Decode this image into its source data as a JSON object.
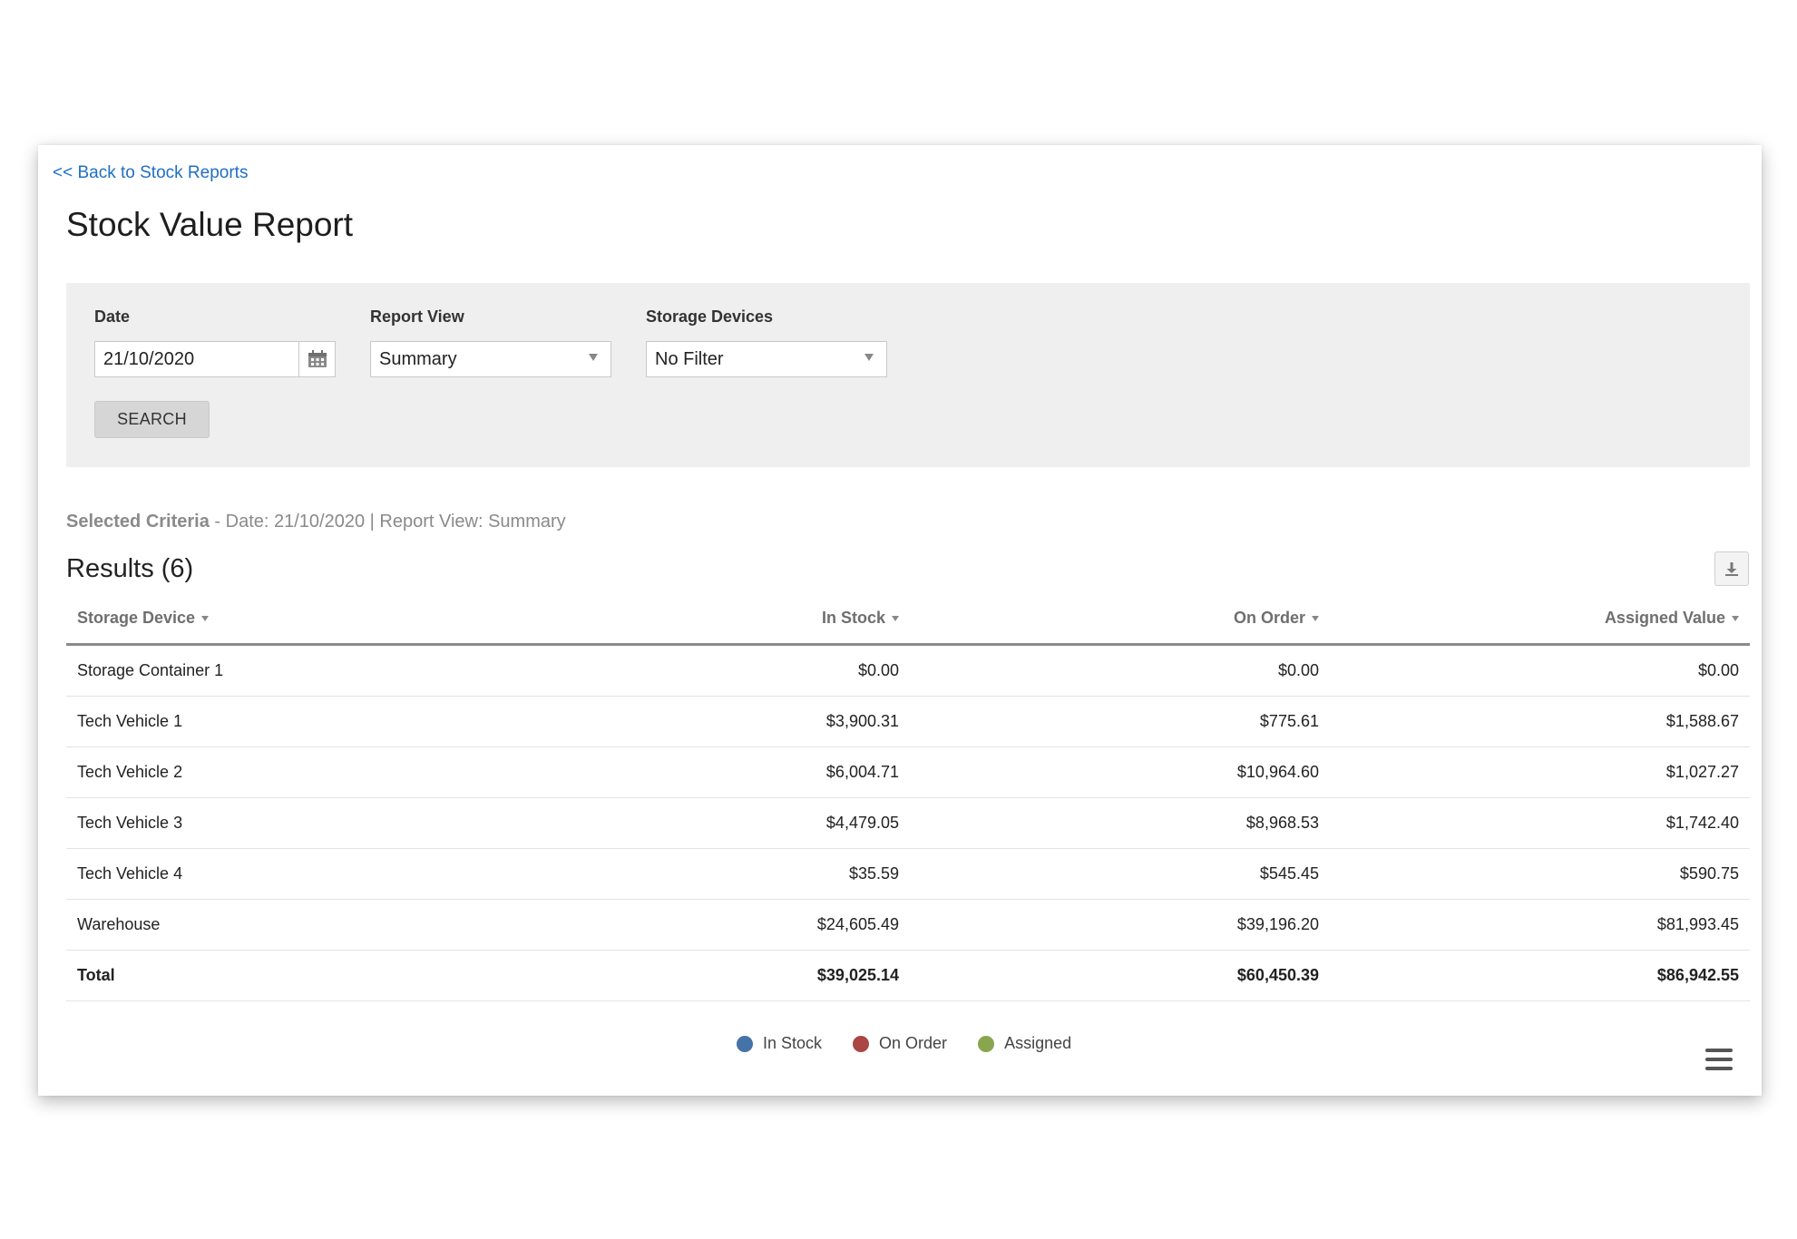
{
  "nav": {
    "back_link": "<< Back to Stock Reports"
  },
  "page": {
    "title": "Stock Value Report"
  },
  "filters": {
    "date": {
      "label": "Date",
      "value": "21/10/2020"
    },
    "report_view": {
      "label": "Report View",
      "selected": "Summary"
    },
    "storage_devices": {
      "label": "Storage Devices",
      "selected": "No Filter"
    },
    "search_label": "SEARCH"
  },
  "criteria": {
    "label": "Selected Criteria",
    "text": " - Date: 21/10/2020 | Report View: Summary"
  },
  "results": {
    "title": "Results (6)",
    "columns": [
      "Storage Device",
      "In Stock",
      "On Order",
      "Assigned Value"
    ],
    "rows": [
      [
        "Storage Container 1",
        "$0.00",
        "$0.00",
        "$0.00"
      ],
      [
        "Tech Vehicle 1",
        "$3,900.31",
        "$775.61",
        "$1,588.67"
      ],
      [
        "Tech Vehicle 2",
        "$6,004.71",
        "$10,964.60",
        "$1,027.27"
      ],
      [
        "Tech Vehicle 3",
        "$4,479.05",
        "$8,968.53",
        "$1,742.40"
      ],
      [
        "Tech Vehicle 4",
        "$35.59",
        "$545.45",
        "$590.75"
      ],
      [
        "Warehouse",
        "$24,605.49",
        "$39,196.20",
        "$81,993.45"
      ]
    ],
    "total": [
      "Total",
      "$39,025.14",
      "$60,450.39",
      "$86,942.55"
    ]
  },
  "legend": [
    {
      "label": "In Stock",
      "color": "#4572a7"
    },
    {
      "label": "On Order",
      "color": "#aa4643"
    },
    {
      "label": "Assigned",
      "color": "#89a54e"
    }
  ],
  "icons": {
    "calendar": "calendar-icon",
    "download": "download-icon",
    "menu": "hamburger-menu-icon"
  }
}
